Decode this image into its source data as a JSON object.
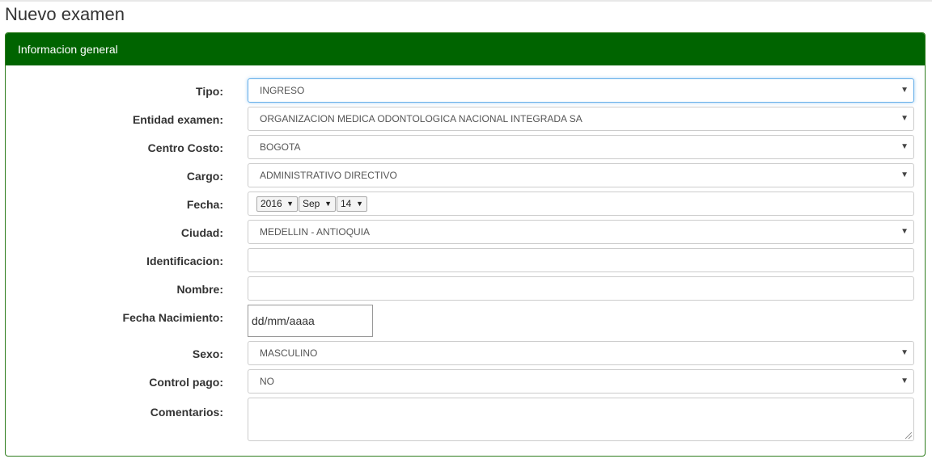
{
  "page": {
    "title": "Nuevo examen"
  },
  "panel": {
    "heading": "Informacion general"
  },
  "form": {
    "tipo": {
      "label": "Tipo:",
      "value": "INGRESO"
    },
    "entidad": {
      "label": "Entidad examen:",
      "value": "ORGANIZACION MEDICA ODONTOLOGICA NACIONAL INTEGRADA SA"
    },
    "centro_costo": {
      "label": "Centro Costo:",
      "value": "BOGOTA"
    },
    "cargo": {
      "label": "Cargo:",
      "value": "ADMINISTRATIVO DIRECTIVO"
    },
    "fecha": {
      "label": "Fecha:",
      "year": "2016",
      "month": "Sep",
      "day": "14"
    },
    "ciudad": {
      "label": "Ciudad:",
      "value": "MEDELLIN - ANTIOQUIA"
    },
    "identificacion": {
      "label": "Identificacion:",
      "value": ""
    },
    "nombre": {
      "label": "Nombre:",
      "value": ""
    },
    "fecha_nacimiento": {
      "label": "Fecha Nacimiento:",
      "placeholder": "dd/mm/aaaa"
    },
    "sexo": {
      "label": "Sexo:",
      "value": "MASCULINO"
    },
    "control_pago": {
      "label": "Control pago:",
      "value": "NO"
    },
    "comentarios": {
      "label": "Comentarios:",
      "value": ""
    }
  },
  "icons": {
    "dropdown_caret": "triangle-down-icon",
    "resize_grip": "resize-grip-icon"
  },
  "colors": {
    "panel_heading_bg": "#006400",
    "panel_border": "#2f7d1e",
    "focus_border": "#66afe9"
  }
}
